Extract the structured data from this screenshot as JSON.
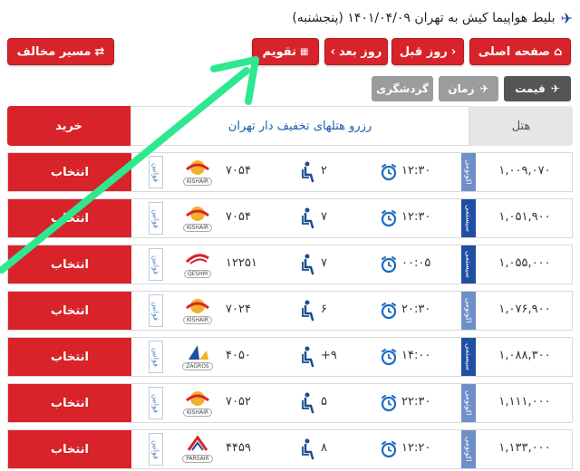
{
  "header": {
    "title": "بلیط هواپیما کیش به تهران ۱۴۰۱/۰۴/۰۹ (پنجشنبه)"
  },
  "nav": {
    "home": "صفحه اصلی",
    "prev_day": "روز قبل",
    "next_day": "روز بعد",
    "calendar": "تقویم",
    "reverse": "مسیر مخالف"
  },
  "sort": {
    "price": "قیمت",
    "time": "زمان",
    "tour": "گردشگری"
  },
  "table_header": {
    "buy": "خرید",
    "promo": "رزرو هتلهای تخفیف دار تهران",
    "hotel": "هتل"
  },
  "flights": [
    {
      "buy": "انتخاب",
      "agency": "قوانین",
      "airline": "KISHAIR",
      "flight": "۷۰۵۴",
      "seats": "۲",
      "time": "۱۲:۳۰",
      "class": "اکونومی",
      "price": "۱,۰۰۹,۰۷۰"
    },
    {
      "buy": "انتخاب",
      "agency": "قوانین",
      "airline": "KISHAIR",
      "flight": "۷۰۵۴",
      "seats": "۷",
      "time": "۱۲:۳۰",
      "class": "سیستمی",
      "price": "۱,۰۵۱,۹۰۰"
    },
    {
      "buy": "انتخاب",
      "agency": "قوانین",
      "airline": "QESHM",
      "flight": "۱۲۲۵۱",
      "seats": "۷",
      "time": "۰۰:۰۵",
      "class": "سیستمی",
      "price": "۱,۰۵۵,۰۰۰"
    },
    {
      "buy": "انتخاب",
      "agency": "قوانین",
      "airline": "KISHAIR",
      "flight": "۷۰۲۴",
      "seats": "۶",
      "time": "۲۰:۳۰",
      "class": "اکونومی",
      "price": "۱,۰۷۶,۹۰۰"
    },
    {
      "buy": "انتخاب",
      "agency": "قوانین",
      "airline": "ZAGROS",
      "flight": "۴۰۵۰",
      "seats": "+۹",
      "time": "۱۴:۰۰",
      "class": "سیستمی",
      "price": "۱,۰۸۸,۳۰۰"
    },
    {
      "buy": "انتخاب",
      "agency": "قوانین",
      "airline": "KISHAIR",
      "flight": "۷۰۵۲",
      "seats": "۵",
      "time": "۲۲:۳۰",
      "class": "اکونومی",
      "price": "۱,۱۱۱,۰۰۰"
    },
    {
      "buy": "انتخاب",
      "agency": "قوانین",
      "airline": "PARSAIR",
      "flight": "۴۴۵۹",
      "seats": "۸",
      "time": "۱۲:۲۰",
      "class": "اکونومی",
      "price": "۱,۱۳۳,۰۰۰"
    }
  ],
  "colors": {
    "primary_red": "#d8232a",
    "economy_blue": "#6f8fc9",
    "system_blue": "#1e4fa3",
    "arrow_green": "#2ee88f"
  }
}
